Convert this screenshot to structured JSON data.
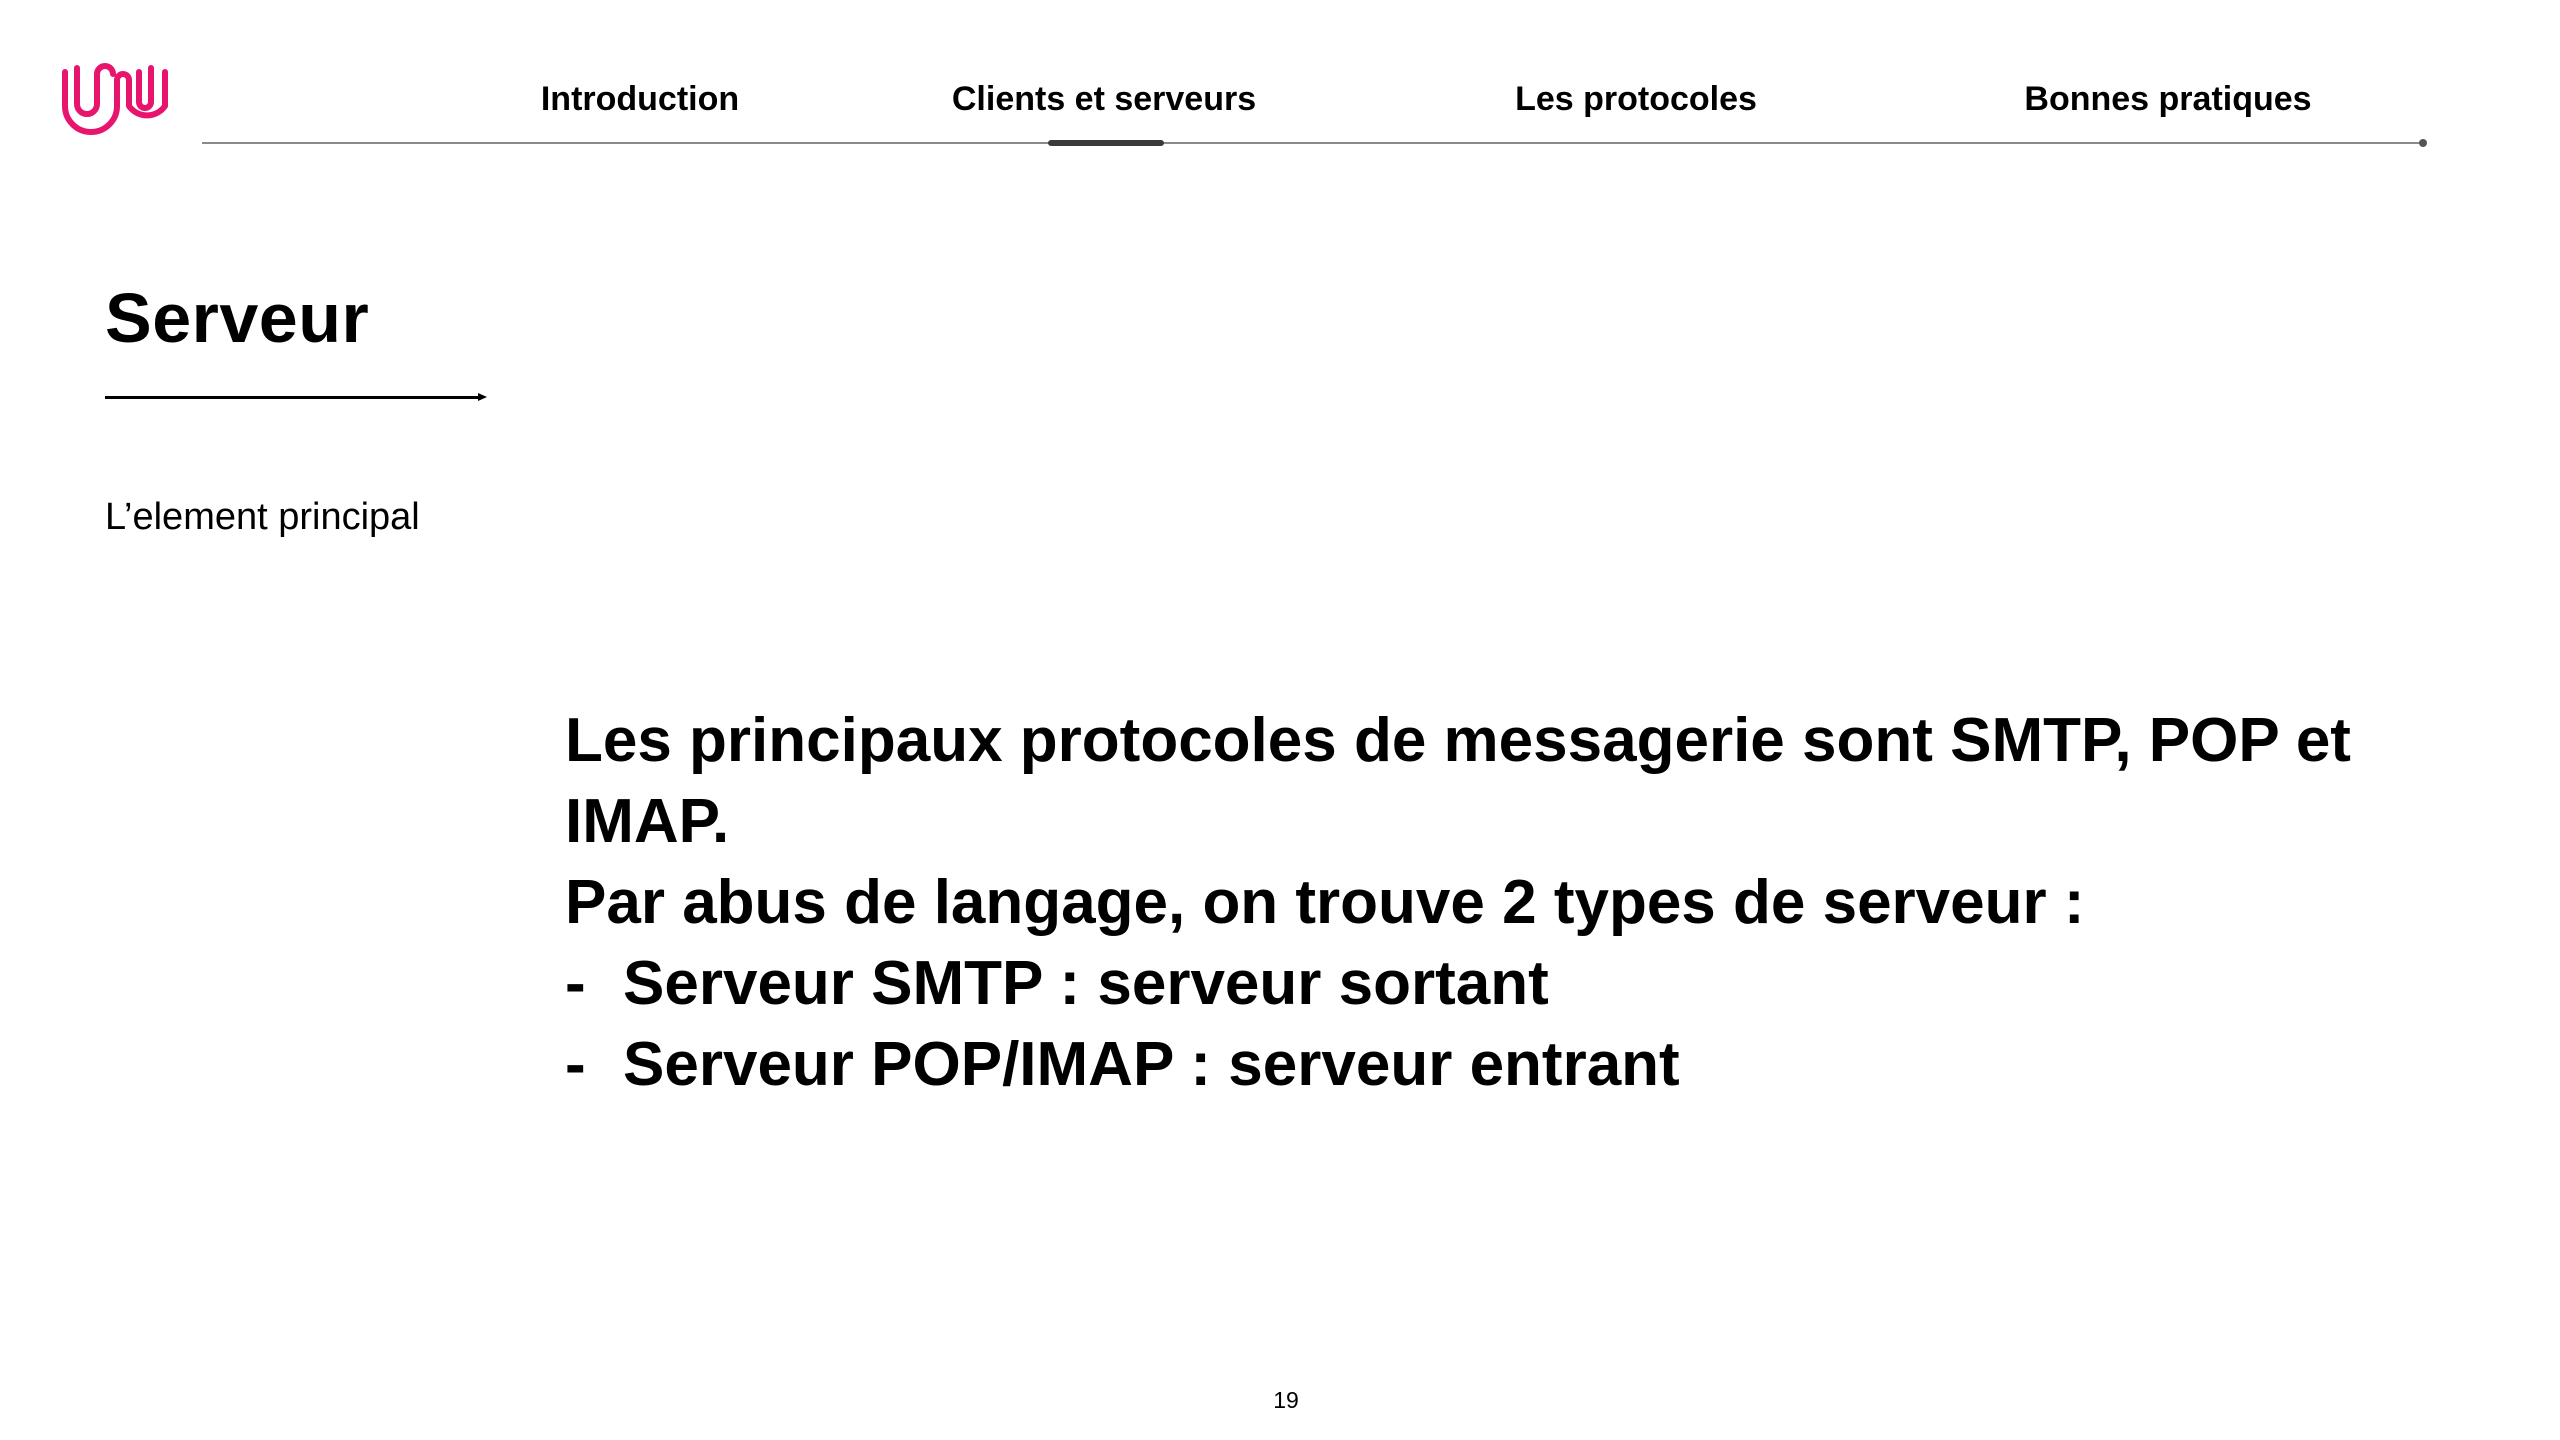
{
  "brand": {
    "accent_color": "#e8156f",
    "logo_icon": "wavy-w-logo-icon"
  },
  "nav": {
    "items": [
      {
        "label": "Introduction"
      },
      {
        "label": "Clients et serveurs",
        "active": true
      },
      {
        "label": "Les protocoles"
      },
      {
        "label": "Bonnes pratiques"
      }
    ]
  },
  "slide": {
    "title": "Serveur",
    "subtitle": "L’element principal",
    "body": {
      "paragraph1": "Les principaux protocoles de messagerie sont SMTP, POP et IMAP.",
      "paragraph2": "Par abus de langage, on trouve 2 types de serveur :",
      "bullet_marker": "-",
      "bullets": [
        "Serveur SMTP : serveur sortant",
        "Serveur POP/IMAP : serveur entrant"
      ]
    },
    "page_number": "19"
  }
}
